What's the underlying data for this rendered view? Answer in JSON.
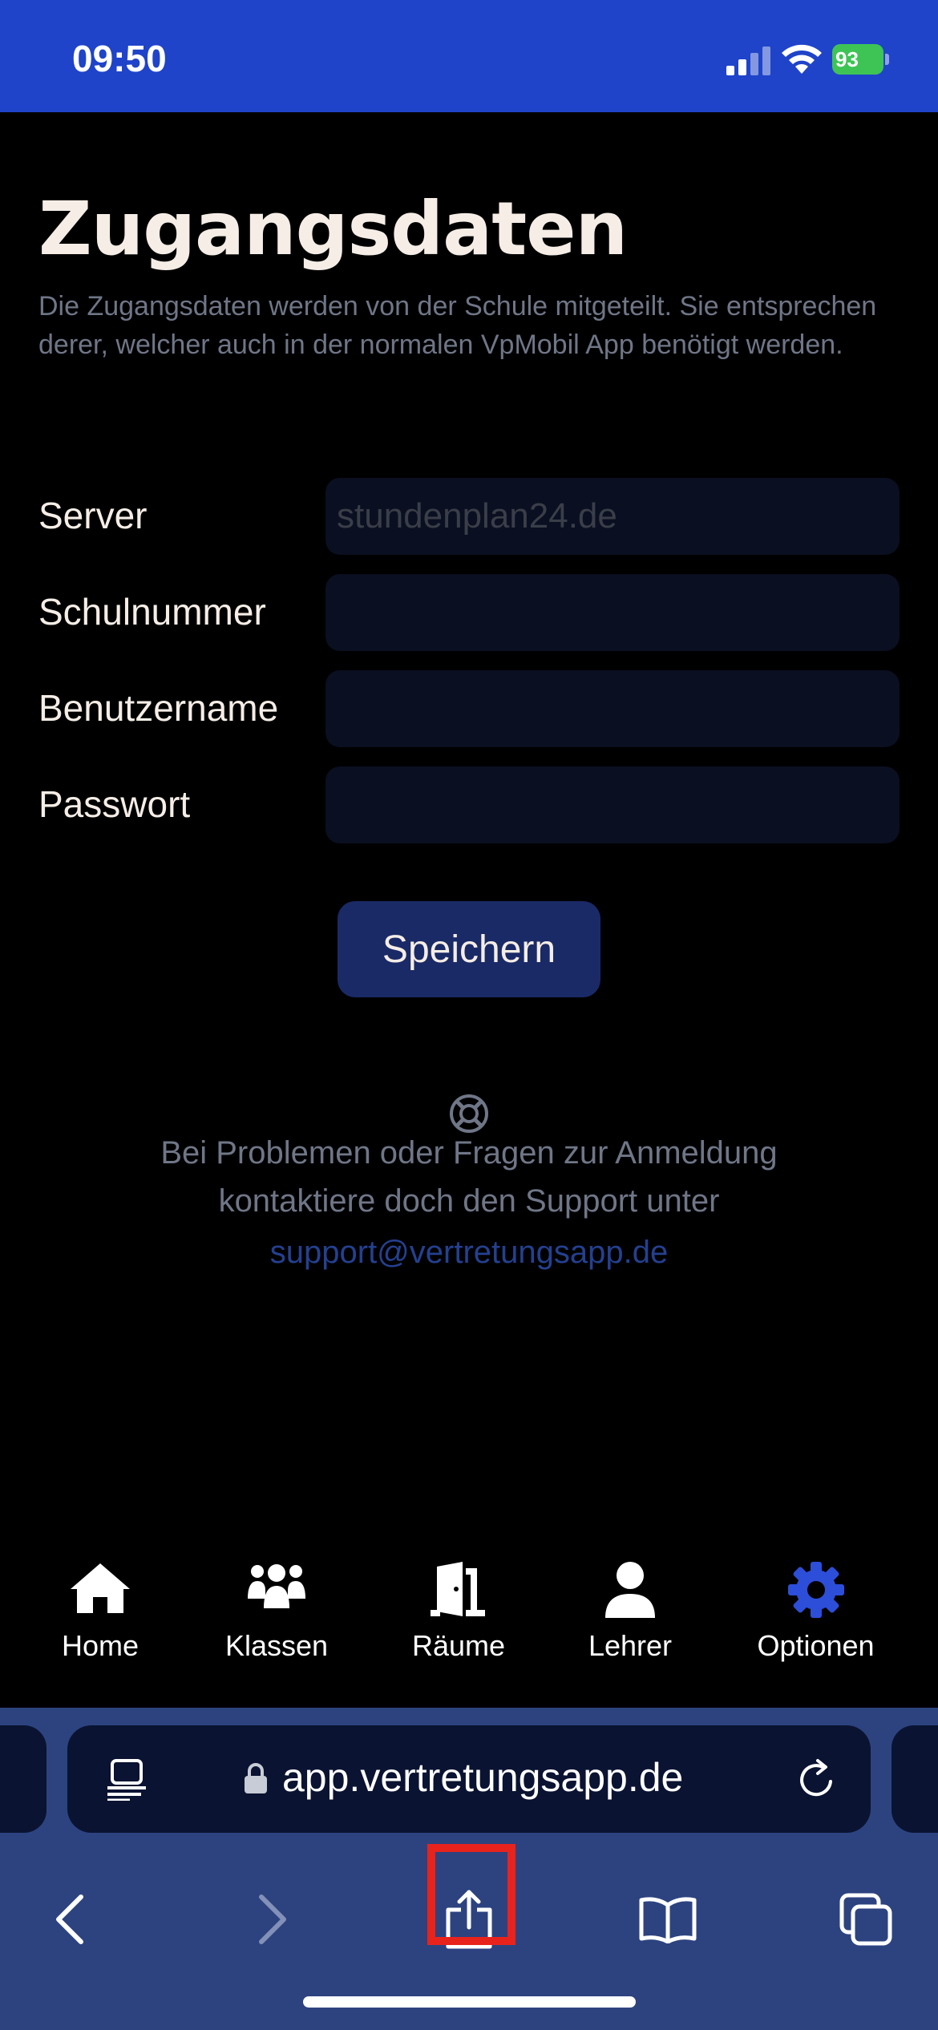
{
  "status_bar": {
    "time": "09:50",
    "battery": "93",
    "icons": [
      "cellular-signal-icon",
      "wifi-icon",
      "battery-charging-icon"
    ]
  },
  "page": {
    "title": "Zugangsdaten",
    "description": "Die Zugangsdaten werden von der Schule mitgeteilt. Sie entsprechen derer, welcher auch in der normalen VpMobil App benötigt werden."
  },
  "form": {
    "server": {
      "label": "Server",
      "value": "",
      "placeholder": "stundenplan24.de"
    },
    "school_number": {
      "label": "Schulnummer",
      "value": "",
      "placeholder": ""
    },
    "username": {
      "label": "Benutzername",
      "value": "",
      "placeholder": ""
    },
    "password": {
      "label": "Passwort",
      "value": "",
      "placeholder": ""
    },
    "save_label": "Speichern"
  },
  "support": {
    "icon": "lifebuoy-icon",
    "line1": "Bei Problemen oder Fragen zur Anmeldung",
    "line2": "kontaktiere doch den Support unter",
    "email": "support@vertretungsapp.de"
  },
  "bottom_nav": {
    "items": [
      {
        "label": "Home",
        "icon": "home-icon",
        "active": false
      },
      {
        "label": "Klassen",
        "icon": "users-icon",
        "active": false
      },
      {
        "label": "Räume",
        "icon": "door-open-icon",
        "active": false
      },
      {
        "label": "Lehrer",
        "icon": "user-icon",
        "active": false
      },
      {
        "label": "Optionen",
        "icon": "gear-icon",
        "active": true
      }
    ],
    "active_color": "#2d4ed8",
    "inactive_color": "#ffffff"
  },
  "browser": {
    "url": "app.vertretungsapp.de",
    "toolbar": [
      "back-icon",
      "forward-icon",
      "share-icon",
      "bookmarks-icon",
      "tabs-icon"
    ],
    "highlight_color": "#e8231c"
  },
  "colors": {
    "status_bar_bg": "#1f44c9",
    "background": "#000000",
    "input_bg": "#0a0f21",
    "button_bg": "#1a2a66",
    "link": "#24408f",
    "browser_bg": "#2d4380"
  }
}
